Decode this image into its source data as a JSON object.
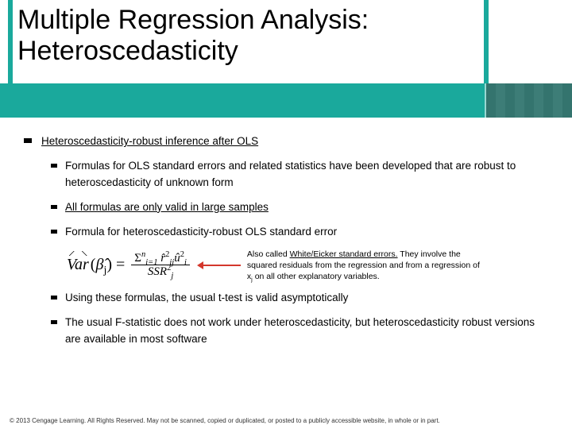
{
  "header": {
    "title_line1": "Multiple Regression Analysis:",
    "title_line2": "Heteroscedasticity"
  },
  "content": {
    "lvl1_heading": "Heteroscedasticity-robust inference after OLS",
    "item1": "Formulas for OLS standard errors and related statistics have been developed that are robust to heteroscedasticity of unknown form",
    "item2": "All formulas are only valid in large samples",
    "item3": "Formula for heteroscedasticity-robust OLS standard error",
    "formula": {
      "lhs_var": "Var",
      "lhs_arg": "β",
      "lhs_sub": "j",
      "sum_prefix": "Σ",
      "sum_lower": "i=1",
      "sum_upper": "n",
      "num_r": "r̂",
      "num_r_sub": "ij",
      "num_r_sup": "2",
      "num_u": "û",
      "num_u_sub": "i",
      "num_u_sup": "2",
      "den_base": "SSR",
      "den_sub": "j",
      "den_sup": "2"
    },
    "annotation_part1": "Also called ",
    "annotation_u": "White/Eicker standard errors.",
    "annotation_part2": " They involve the squared residuals from the regression and from a regression of x",
    "annotation_sub": "j",
    "annotation_part3": " on all other explanatory variables.",
    "item4": "Using these formulas, the usual t-test is valid asymptotically",
    "item5": "The usual F-statistic does not work under heteroscedasticity, but heteroscedasticity robust versions are available in most software"
  },
  "footer": "© 2013 Cengage Learning. All Rights Reserved. May not be scanned, copied or duplicated, or posted to a publicly accessible website, in whole or in part."
}
